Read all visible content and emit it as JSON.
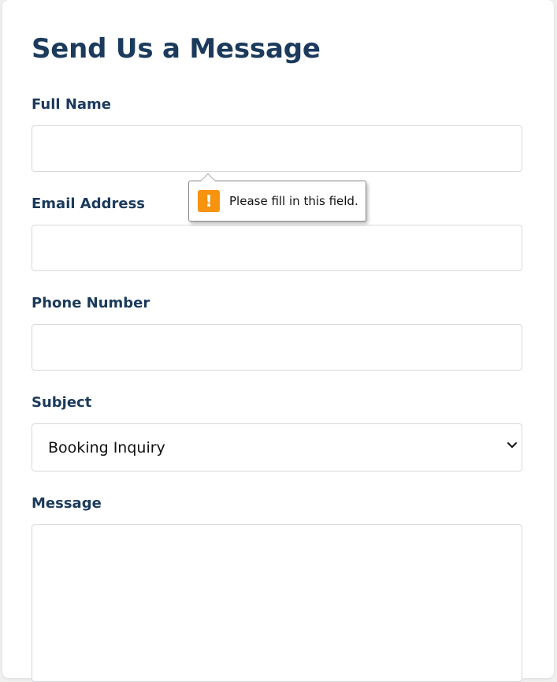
{
  "form": {
    "title": "Send Us a Message",
    "fields": {
      "full_name": {
        "label": "Full Name",
        "value": ""
      },
      "email": {
        "label": "Email Address",
        "value": ""
      },
      "phone": {
        "label": "Phone Number",
        "value": ""
      },
      "subject": {
        "label": "Subject",
        "selected": "Booking Inquiry"
      },
      "message": {
        "label": "Message",
        "value": ""
      }
    }
  },
  "validation_tooltip": {
    "icon": "warning-icon",
    "text": "Please fill in this field.",
    "icon_color": "#f7930e"
  },
  "colors": {
    "heading": "#1b3a5c",
    "field_border": "#d5d9dd"
  }
}
